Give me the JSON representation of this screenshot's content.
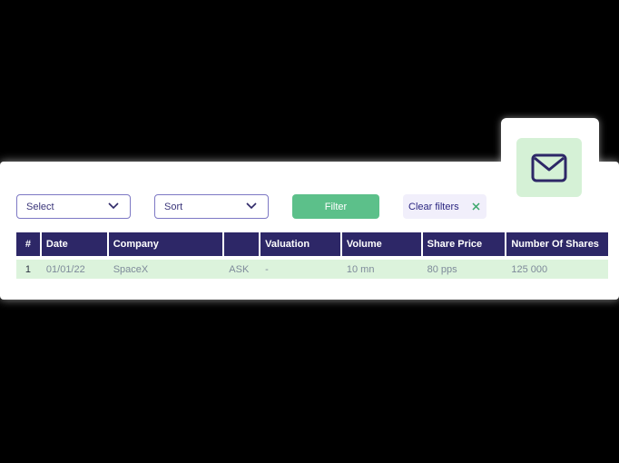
{
  "filters": {
    "select_label": "Select",
    "sort_label": "Sort",
    "filter_button": "Filter",
    "clear_filters": "Clear filters"
  },
  "table": {
    "headers": [
      "#",
      "Date",
      "Company",
      "",
      "Valuation",
      "Volume",
      "Share Price",
      "Number Of Shares"
    ],
    "rows": [
      {
        "num": "1",
        "date": "01/01/22",
        "company": "SpaceX",
        "side": "ASK",
        "valuation": "-",
        "volume": "10 mn",
        "share_price": "80 pps",
        "shares": "125 000"
      }
    ]
  },
  "icons": {
    "mail": "envelope-icon",
    "select_chevron": "chevron-down-icon",
    "clear": "close-icon"
  },
  "colors": {
    "header_bg": "#2d2767",
    "row_bg": "#dcf3dc",
    "filter_button": "#5cc08a",
    "mail_tile": "#d5f1d6"
  }
}
